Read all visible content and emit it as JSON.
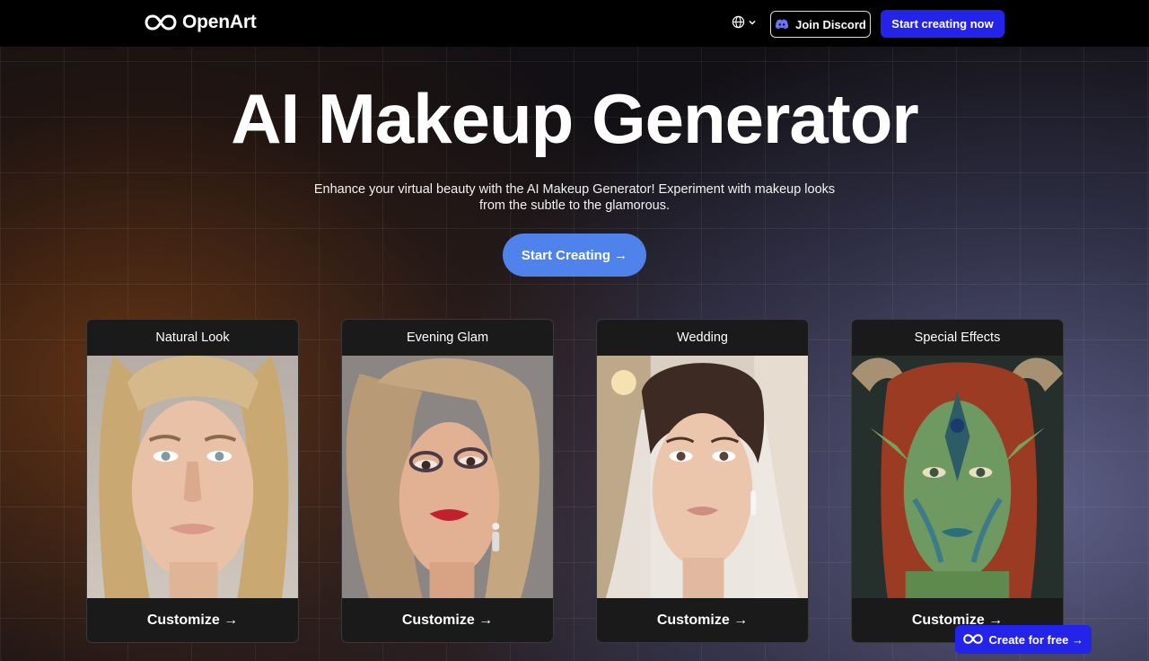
{
  "header": {
    "logo_text": "OpenArt",
    "language_icon": "globe-icon",
    "discord_label": "Join Discord",
    "start_now_label": "Start creating now"
  },
  "hero": {
    "title": "AI Makeup Generator",
    "description": "Enhance your virtual beauty with the AI Makeup Generator! Experiment with makeup looks from the subtle to the glamorous.",
    "cta_label": "Start Creating →"
  },
  "cards": [
    {
      "title": "Natural Look",
      "button": "Customize →"
    },
    {
      "title": "Evening Glam",
      "button": "Customize →"
    },
    {
      "title": "Wedding",
      "button": "Customize →"
    },
    {
      "title": "Special Effects",
      "button": "Customize →"
    }
  ],
  "floating_cta": {
    "label": "Create for free →"
  },
  "colors": {
    "accent_blue": "#2323ea",
    "cta_blue": "#4f82ea",
    "card_bg": "#1a1a1a"
  }
}
